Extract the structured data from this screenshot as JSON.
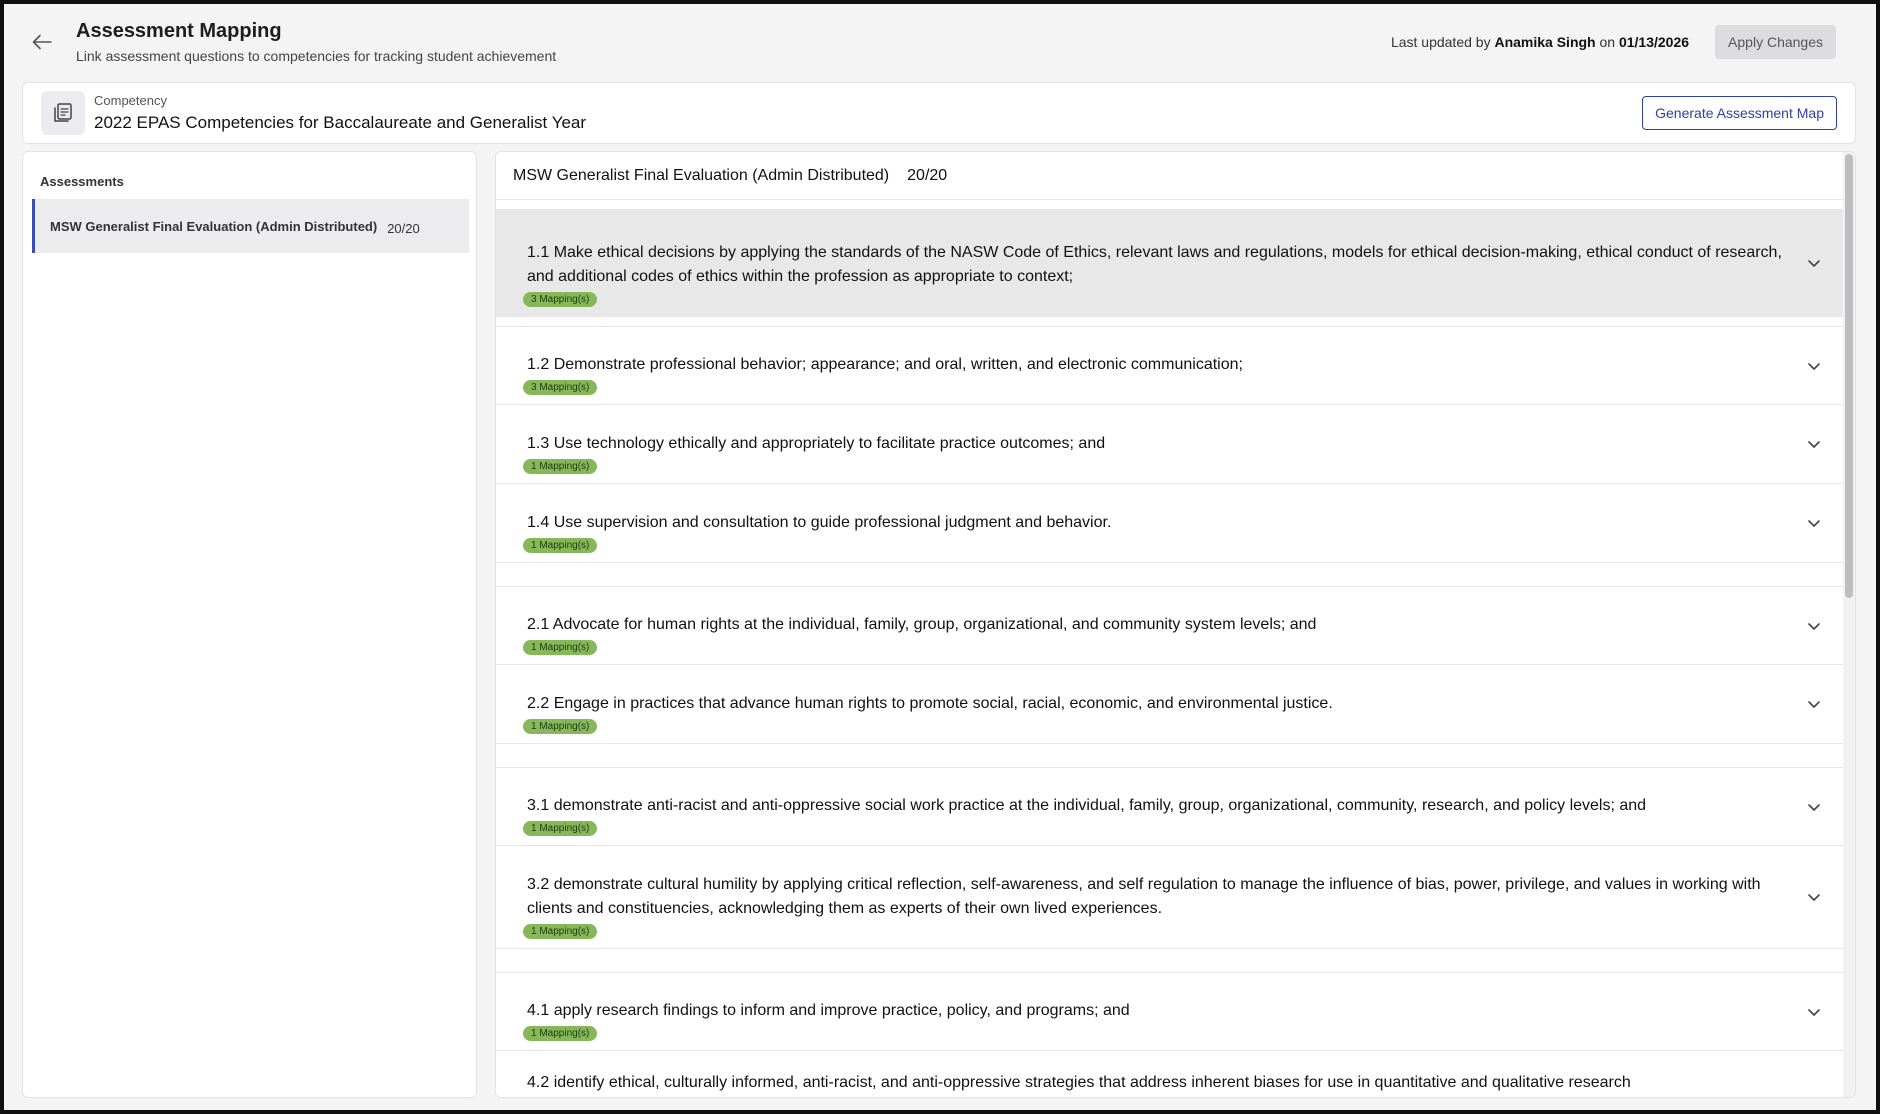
{
  "header": {
    "title": "Assessment Mapping",
    "subtitle": "Link assessment questions to competencies for tracking student achievement",
    "last_updated_prefix": "Last updated by",
    "last_updated_user": "Anamika Singh",
    "last_updated_on": "on",
    "last_updated_date": "01/13/2026",
    "apply_label": "Apply Changes"
  },
  "competency": {
    "label": "Competency",
    "value": "2022 EPAS Competencies for Baccalaureate and Generalist Year",
    "generate_label": "Generate Assessment Map"
  },
  "sidebar": {
    "title": "Assessments",
    "items": [
      {
        "label": "MSW Generalist Final Evaluation (Admin Distributed)",
        "count": "20/20"
      }
    ]
  },
  "main": {
    "title": "MSW Generalist Final Evaluation (Admin Distributed)",
    "count": "20/20",
    "rows": [
      {
        "text": "1.1 Make ethical decisions by applying the standards of the NASW Code of Ethics, relevant laws and regulations, models for ethical decision-making, ethical conduct of research, and additional codes of ethics within the profession as appropriate to context;",
        "badge": "3 Mapping(s)"
      },
      {
        "text": "1.2 Demonstrate professional behavior; appearance; and oral, written, and electronic communication;",
        "badge": "3 Mapping(s)"
      },
      {
        "text": "1.3 Use technology ethically and appropriately to facilitate practice outcomes; and",
        "badge": "1 Mapping(s)"
      },
      {
        "text": "1.4 Use supervision and consultation to guide professional judgment and behavior.",
        "badge": "1 Mapping(s)"
      },
      {
        "text": "2.1 Advocate for human rights at the individual, family, group, organizational, and community system levels; and",
        "badge": "1 Mapping(s)"
      },
      {
        "text": "2.2 Engage in practices that advance human rights to promote social, racial, economic, and environmental justice.",
        "badge": "1 Mapping(s)"
      },
      {
        "text": "3.1 demonstrate anti-racist and anti-oppressive social work practice at the individual, family, group, organizational, community, research, and policy levels; and",
        "badge": "1 Mapping(s)"
      },
      {
        "text": "3.2 demonstrate cultural humility by applying critical reflection, self-awareness, and self regulation to manage the influence of bias, power, privilege, and values in working with clients and constituencies, acknowledging them as experts of their own lived experiences.",
        "badge": "1 Mapping(s)"
      },
      {
        "text": "4.1 apply research findings to inform and improve practice, policy, and programs; and",
        "badge": "1 Mapping(s)"
      },
      {
        "text": "4.2 identify ethical, culturally informed, anti-racist, and anti-oppressive strategies that address inherent biases for use in quantitative and qualitative research",
        "badge": ""
      }
    ]
  }
}
